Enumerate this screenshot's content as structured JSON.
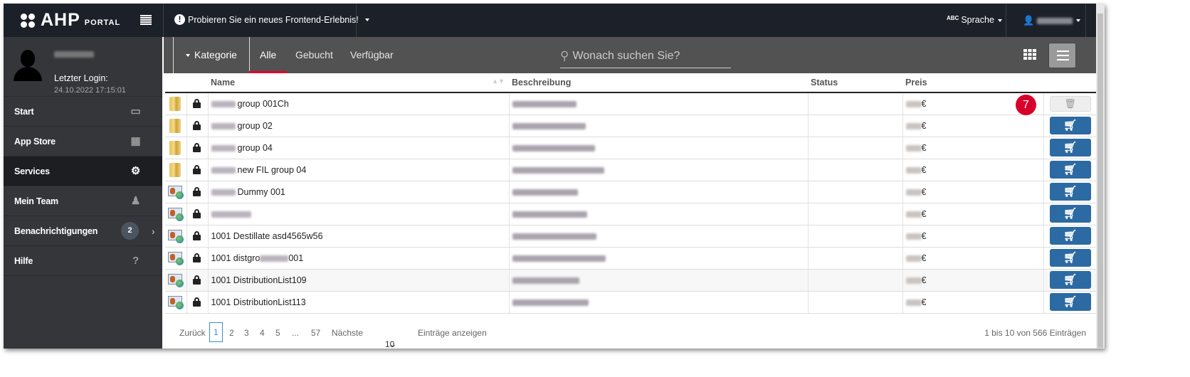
{
  "topbar": {
    "brand": "AHP",
    "brand_sub": "PORTAL",
    "notice": "Probieren Sie ein neues Frontend-Erlebnis!",
    "language": "Sprache",
    "language_icon": "ABC"
  },
  "profile": {
    "last_login_label": "Letzter Login:",
    "last_login": "24.10.2022 17:15:01"
  },
  "sidebar": {
    "items": [
      {
        "label": "Start",
        "icon": "monitor-icon"
      },
      {
        "label": "App Store",
        "icon": "notebook-icon"
      },
      {
        "label": "Services",
        "icon": "gear-icon"
      },
      {
        "label": "Mein Team",
        "icon": "team-icon"
      },
      {
        "label": "Benachrichtigungen",
        "icon": "bell-icon",
        "badge": "2"
      },
      {
        "label": "Hilfe",
        "icon": "question-icon"
      }
    ]
  },
  "toolbar": {
    "category": "Kategorie",
    "tabs": [
      "Alle",
      "Gebucht",
      "Verfügbar"
    ],
    "search_placeholder": "Wonach suchen Sie?"
  },
  "table": {
    "headers": [
      "Name",
      "Beschreibung",
      "Status",
      "Preis"
    ],
    "currency": "€",
    "badge_count": "7",
    "rows": [
      {
        "type": "folder",
        "name": "group 001Ch",
        "action": "delete"
      },
      {
        "type": "folder",
        "name": "group 02",
        "action": "cart"
      },
      {
        "type": "folder",
        "name": "group 04",
        "action": "cart"
      },
      {
        "type": "folder",
        "name": "new FIL group 04",
        "action": "cart"
      },
      {
        "type": "distribution",
        "name": "Dummy 001",
        "action": "cart"
      },
      {
        "type": "distribution",
        "name": "",
        "action": "cart"
      },
      {
        "type": "distribution",
        "name": "1001 Destillate asd4565w56",
        "action": "cart"
      },
      {
        "type": "distribution",
        "name": "1001 distgro",
        "name_suffix": "001",
        "action": "cart"
      },
      {
        "type": "distribution",
        "name": "1001 DistributionList109",
        "action": "cart"
      },
      {
        "type": "distribution",
        "name": "1001 DistributionList113",
        "action": "cart"
      }
    ]
  },
  "pagination": {
    "prev": "Zurück",
    "pages": [
      "1",
      "2",
      "3",
      "4",
      "5",
      "...",
      "57"
    ],
    "next": "Nächste",
    "page_size": "10",
    "page_size_label": "Einträge anzeigen",
    "summary": "1 bis 10 von 566 Einträgen"
  },
  "colors": {
    "topbar": "#1c2129",
    "sidebar": "#34363a",
    "toolbar": "#525252",
    "accent": "#e2002b",
    "cart": "#2c6aa3"
  }
}
